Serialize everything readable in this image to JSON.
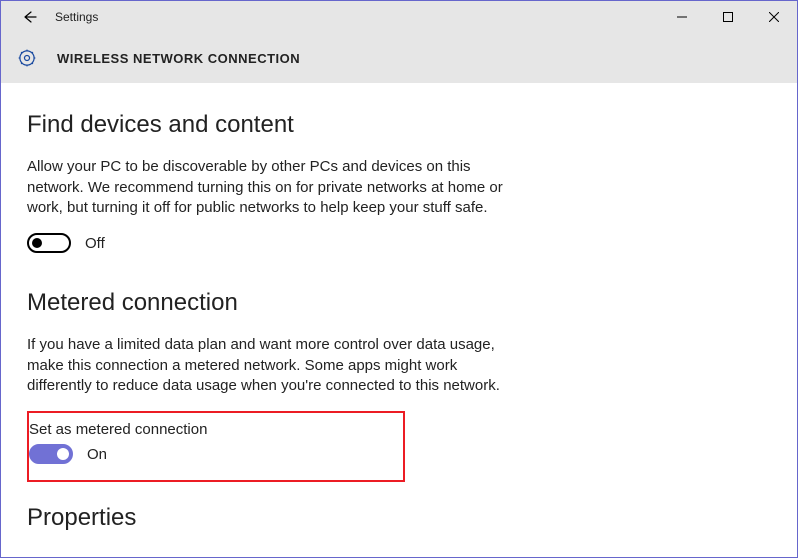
{
  "titlebar": {
    "title": "Settings"
  },
  "header": {
    "page_title": "WIRELESS NETWORK CONNECTION"
  },
  "section_find": {
    "heading": "Find devices and content",
    "text": "Allow your PC to be discoverable by other PCs and devices on this network. We recommend turning this on for private networks at home or work, but turning it off for public networks to help keep your stuff safe.",
    "toggle_label": "Off",
    "toggle_on": false
  },
  "section_metered": {
    "heading": "Metered connection",
    "text": "If you have a limited data plan and want more control over data usage, make this connection a metered network. Some apps might work differently to reduce data usage when you're connected to this network.",
    "set_label": "Set as metered connection",
    "toggle_label": "On",
    "toggle_on": true
  },
  "section_properties": {
    "heading": "Properties"
  }
}
